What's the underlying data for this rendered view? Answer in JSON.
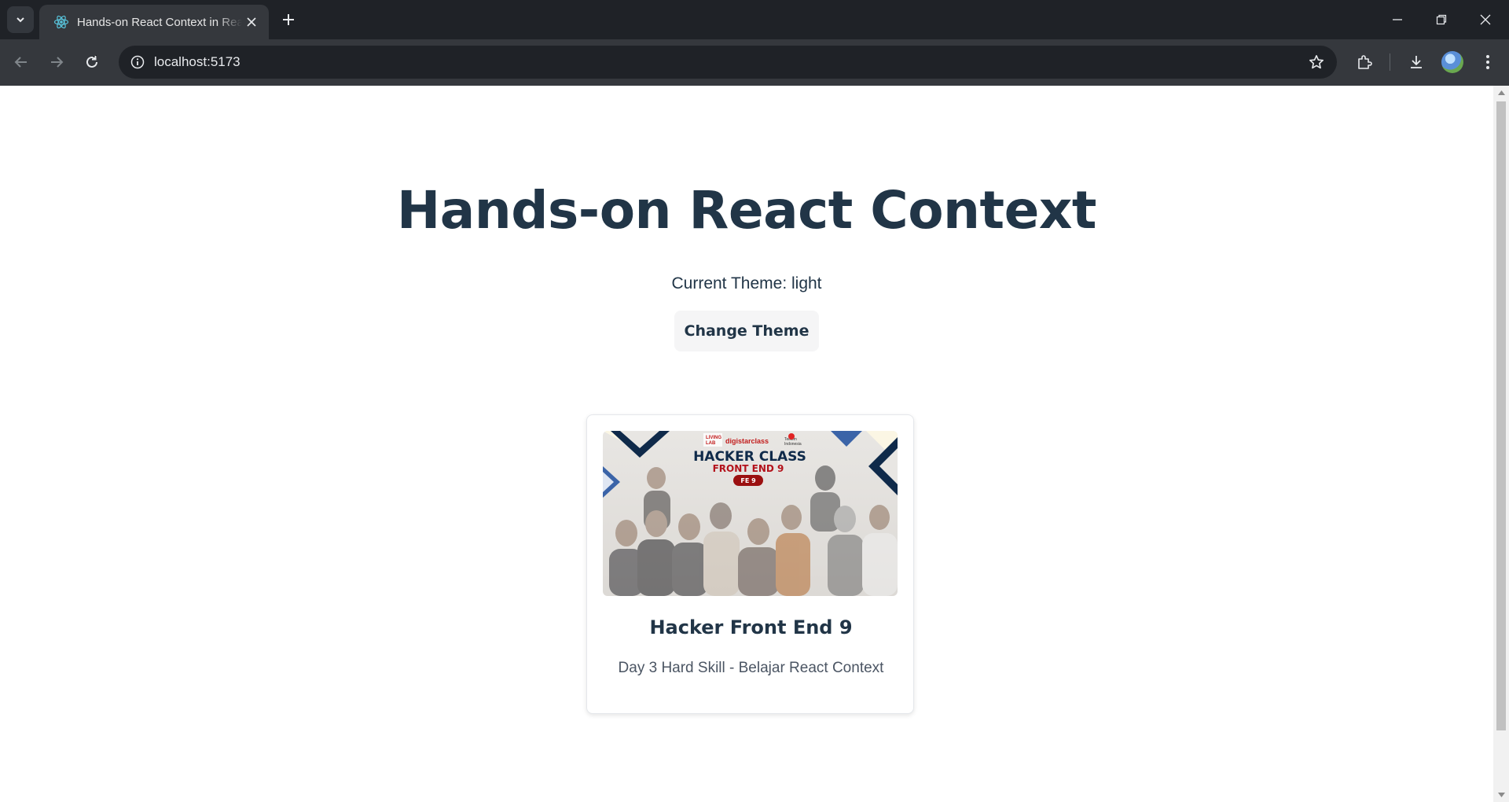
{
  "browser": {
    "tab_title": "Hands-on React Context in React",
    "url": "localhost:5173"
  },
  "icons": {
    "tab_search": "chevron-down-icon",
    "favicon": "react-icon",
    "tab_close": "close-icon",
    "new_tab": "plus-icon",
    "minimize": "minimize-icon",
    "restore": "restore-icon",
    "close_window": "close-icon",
    "back": "arrow-left-icon",
    "forward": "arrow-right-icon",
    "reload": "reload-icon",
    "site_info": "info-icon",
    "bookmark": "star-icon",
    "extensions": "puzzle-icon",
    "downloads": "download-icon",
    "menu": "kebab-icon"
  },
  "page": {
    "heading": "Hands-on React Context",
    "theme_label": "Current Theme: light",
    "change_theme_button": "Change Theme"
  },
  "card": {
    "image": {
      "banner_title": "HACKER CLASS",
      "banner_subtitle": "FRONT END 9",
      "banner_badge": "FE 9",
      "sponsor_1": "LIVING LAB",
      "sponsor_2": "digistarclass",
      "sponsor_3": "Telkom Indonesia"
    },
    "title": "Hacker Front End 9",
    "description": "Day 3 Hard Skill - Belajar React Context"
  },
  "colors": {
    "heading": "#213547",
    "chrome_dark": "#1f2227",
    "chrome_toolbar": "#35383d",
    "banner_navy": "#0f2a4a",
    "banner_red": "#b3121b"
  }
}
